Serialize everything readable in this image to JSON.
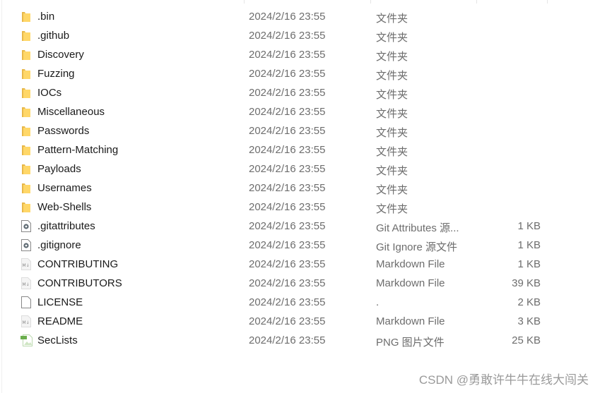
{
  "files": [
    {
      "name": ".bin",
      "date": "2024/2/16 23:55",
      "type": "文件夹",
      "size": "",
      "icon": "folder-icon"
    },
    {
      "name": ".github",
      "date": "2024/2/16 23:55",
      "type": "文件夹",
      "size": "",
      "icon": "folder-icon"
    },
    {
      "name": "Discovery",
      "date": "2024/2/16 23:55",
      "type": "文件夹",
      "size": "",
      "icon": "folder-icon"
    },
    {
      "name": "Fuzzing",
      "date": "2024/2/16 23:55",
      "type": "文件夹",
      "size": "",
      "icon": "folder-icon"
    },
    {
      "name": "IOCs",
      "date": "2024/2/16 23:55",
      "type": "文件夹",
      "size": "",
      "icon": "folder-icon"
    },
    {
      "name": "Miscellaneous",
      "date": "2024/2/16 23:55",
      "type": "文件夹",
      "size": "",
      "icon": "folder-icon"
    },
    {
      "name": "Passwords",
      "date": "2024/2/16 23:55",
      "type": "文件夹",
      "size": "",
      "icon": "folder-icon"
    },
    {
      "name": "Pattern-Matching",
      "date": "2024/2/16 23:55",
      "type": "文件夹",
      "size": "",
      "icon": "folder-icon"
    },
    {
      "name": "Payloads",
      "date": "2024/2/16 23:55",
      "type": "文件夹",
      "size": "",
      "icon": "folder-icon"
    },
    {
      "name": "Usernames",
      "date": "2024/2/16 23:55",
      "type": "文件夹",
      "size": "",
      "icon": "folder-icon"
    },
    {
      "name": "Web-Shells",
      "date": "2024/2/16 23:55",
      "type": "文件夹",
      "size": "",
      "icon": "folder-icon"
    },
    {
      "name": ".gitattributes",
      "date": "2024/2/16 23:55",
      "type": "Git Attributes 源...",
      "size": "1 KB",
      "icon": "settings-file-icon"
    },
    {
      "name": ".gitignore",
      "date": "2024/2/16 23:55",
      "type": "Git Ignore 源文件",
      "size": "1 KB",
      "icon": "settings-file-icon"
    },
    {
      "name": "CONTRIBUTING",
      "date": "2024/2/16 23:55",
      "type": "Markdown File",
      "size": "1 KB",
      "icon": "markdown-file-icon"
    },
    {
      "name": "CONTRIBUTORS",
      "date": "2024/2/16 23:55",
      "type": "Markdown File",
      "size": "39 KB",
      "icon": "markdown-file-icon"
    },
    {
      "name": "LICENSE",
      "date": "2024/2/16 23:55",
      "type": ".",
      "size": "2 KB",
      "icon": "blank-file-icon"
    },
    {
      "name": "README",
      "date": "2024/2/16 23:55",
      "type": "Markdown File",
      "size": "3 KB",
      "icon": "markdown-file-icon"
    },
    {
      "name": "SecLists",
      "date": "2024/2/16 23:55",
      "type": "PNG 图片文件",
      "size": "25 KB",
      "icon": "png-file-icon"
    }
  ],
  "watermark": "CSDN @勇敢许牛牛在线大闯关"
}
